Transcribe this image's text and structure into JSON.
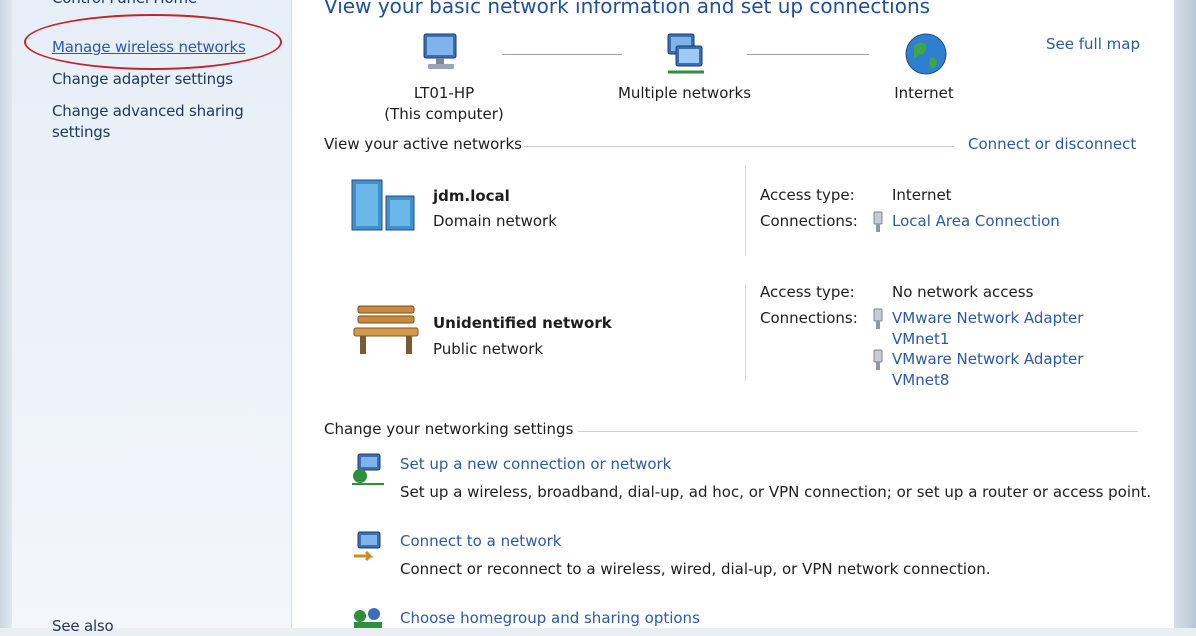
{
  "sidebar": {
    "cut_item": "Control Panel Home",
    "items": [
      {
        "label": "Manage wireless networks"
      },
      {
        "label": "Change adapter settings"
      },
      {
        "label": "Change advanced sharing"
      },
      {
        "label": "settings"
      }
    ],
    "bottom_cut": "See also"
  },
  "main": {
    "title": "View your basic network information and set up connections",
    "see_full_map": "See full map",
    "map": {
      "computer_name": "LT01-HP",
      "computer_sub": "(This computer)",
      "middle": "Multiple networks",
      "end": "Internet"
    },
    "active_header": "View your active networks",
    "connect_disconnect": "Connect or disconnect",
    "networks": [
      {
        "name": "jdm.local",
        "type": "Domain network",
        "access_label": "Access type:",
        "access_value": "Internet",
        "connections_label": "Connections:",
        "connections": [
          "Local Area Connection"
        ]
      },
      {
        "name": "Unidentified network",
        "type": "Public network",
        "access_label": "Access type:",
        "access_value": "No network access",
        "connections_label": "Connections:",
        "connections": [
          "VMware Network Adapter",
          "VMnet1",
          "VMware Network Adapter",
          "VMnet8"
        ]
      }
    ],
    "change_header": "Change your networking settings",
    "tasks": [
      {
        "link": "Set up a new connection or network",
        "desc": "Set up a wireless, broadband, dial-up, ad hoc, or VPN connection; or set up a router or access point."
      },
      {
        "link": "Connect to a network",
        "desc": "Connect or reconnect to a wireless, wired, dial-up, or VPN network connection."
      },
      {
        "link": "Choose homegroup and sharing options",
        "desc": ""
      }
    ]
  },
  "colors": {
    "link": "#2b5aa8",
    "title": "#1e4f9a",
    "highlight_circle": "#c4242e"
  }
}
